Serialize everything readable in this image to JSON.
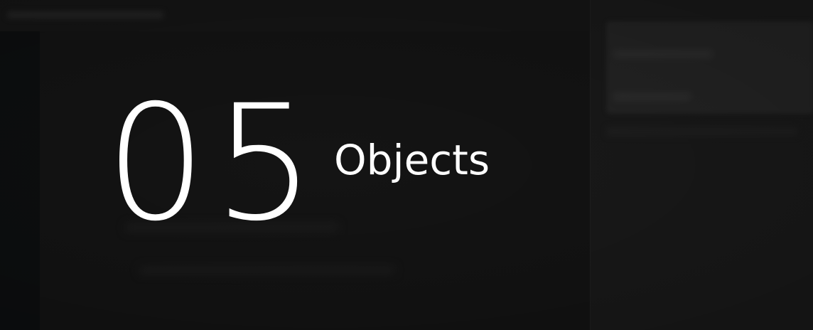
{
  "overlay": {
    "count": "05",
    "unit": "Objects"
  },
  "colors": {
    "background": "#141414",
    "text": "#ffffff",
    "right_panel": "#1a1a1a"
  }
}
